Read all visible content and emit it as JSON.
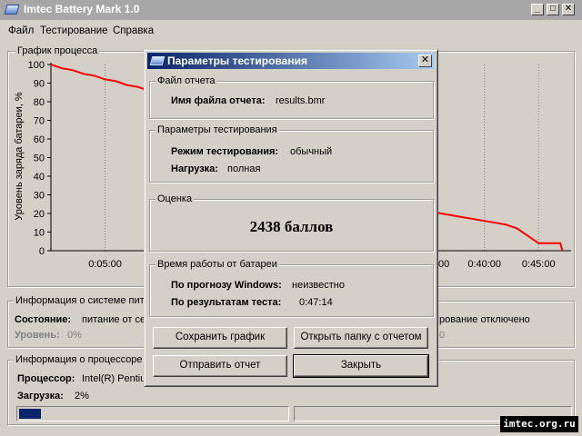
{
  "window": {
    "title": "Imtec Battery Mark 1.0",
    "minimize_label": "_",
    "maximize_label": "□",
    "close_label": "✕"
  },
  "menu": {
    "items": [
      "Файл",
      "Тестирование",
      "Справка"
    ]
  },
  "process_chart": {
    "group_label": "График процесса",
    "ylabel": "Уровень заряда батареи, %",
    "y_ticks": [
      "100",
      "90",
      "80",
      "70",
      "60",
      "50",
      "40",
      "30",
      "20",
      "10",
      "0"
    ],
    "x_ticks_visible": [
      "0:05:00",
      "0:40:00",
      "0:45:00"
    ],
    "x_tick_partial": "00"
  },
  "chart_data": {
    "type": "line",
    "title": "График процесса",
    "xlabel": "",
    "ylabel": "Уровень заряда батареи, %",
    "ylim": [
      0,
      100
    ],
    "x_unit": "h:mm:ss",
    "x_ticks": [
      "0:05:00",
      "0:40:00",
      "0:45:00"
    ],
    "series": [
      {
        "color": "#ff0000",
        "x_minutes_left": [
          0,
          0.5,
          1,
          2,
          3,
          4,
          5,
          6,
          7,
          8,
          9,
          10
        ],
        "y_left": [
          100,
          99,
          98,
          97,
          95,
          94,
          92,
          91,
          89,
          88,
          86,
          85
        ],
        "x_minutes_right": [
          30,
          32,
          34,
          36,
          38,
          40,
          42,
          43,
          44,
          45,
          46,
          47,
          47.2
        ],
        "y_right": [
          26,
          24,
          22,
          20,
          18,
          16,
          14,
          12,
          8,
          4,
          4,
          4,
          0
        ]
      }
    ]
  },
  "system_info": {
    "group_label": "Информация о системе пита",
    "state_label": "Состояние:",
    "state_value": "питание от се",
    "level_label": "Уровень:",
    "level_value": "0%",
    "right_text": "рование отключено",
    "right_value": "0"
  },
  "cpu_info": {
    "group_label": "Информация о процессоре",
    "cpu_label": "Процессор:",
    "cpu_value": "Intel(R) Pentiu",
    "load_label": "Загрузка:",
    "load_value": "2%",
    "load_fraction": 0.02
  },
  "dialog": {
    "title": "Параметры тестирования",
    "close_label": "✕",
    "report_file": {
      "group_label": "Файл отчета",
      "name_label": "Имя файла отчета:",
      "name_value": "results.bmr"
    },
    "params": {
      "group_label": "Параметры тестирования",
      "mode_label": "Режим тестирования:",
      "mode_value": "обычный",
      "load_label": "Нагрузка:",
      "load_value": "полная"
    },
    "rating": {
      "group_label": "Оценка",
      "score": "2438 баллов"
    },
    "runtime": {
      "group_label": "Время работы от батареи",
      "windows_label": "По прогнозу Windows:",
      "windows_value": "неизвестно",
      "test_label": "По результатам теста:",
      "test_value": "0:47:14"
    },
    "buttons": {
      "save_chart": "Сохранить график",
      "open_folder": "Открыть папку с отчетом",
      "send_report": "Отправить отчет",
      "close": "Закрыть"
    }
  },
  "watermark": "imtec.org.ru"
}
